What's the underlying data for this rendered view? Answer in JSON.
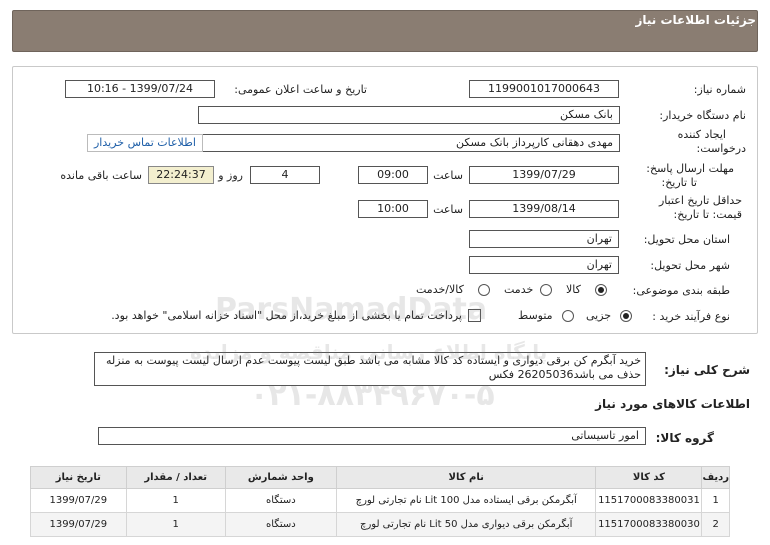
{
  "header": {
    "title": "جزئیات اطلاعات نیاز"
  },
  "form": {
    "need_number_label": "شماره نیاز:",
    "need_number": "1199001017000643",
    "announce_label": "تاریخ و ساعت اعلان عمومی:",
    "announce_value": "1399/07/24 - 10:16",
    "buyer_org_label": "نام دستگاه خریدار:",
    "buyer_org": "بانک مسکن",
    "creator_label_1": "ایجاد کننده",
    "creator_label_2": "درخواست:",
    "creator": "مهدی دهقانی کارپرداز بانک مسکن",
    "contact_link": "اطلاعات تماس خریدار",
    "reply_deadline_label_1": "مهلت ارسال پاسخ:",
    "reply_deadline_label_2": "تا تاریخ:",
    "reply_date": "1399/07/29",
    "time_label": "ساعت",
    "reply_time": "09:00",
    "days_value": "4",
    "days_label": "روز و",
    "remaining_time": "22:24:37",
    "remaining_label": "ساعت باقی مانده",
    "price_validity_label_1": "حداقل تاریخ اعتبار",
    "price_validity_label_2": "قیمت: تا تاریخ:",
    "price_date": "1399/08/14",
    "price_time_label": "ساعت",
    "price_time": "10:00",
    "province_label": "استان محل تحویل:",
    "province": "تهران",
    "city_label": "شهر محل تحویل:",
    "city": "تهران",
    "category_label": "طبقه بندی موضوعی:",
    "category_options": [
      "کالا",
      "خدمت",
      "کالا/خدمت"
    ],
    "category_selected": "کالا",
    "process_label": "نوع فرآیند خرید :",
    "process_options": [
      "جزیی",
      "متوسط"
    ],
    "process_selected": "جزیی",
    "payment_note": "پرداخت تمام یا بخشی از مبلغ خرید،از محل \"اسناد خزانه اسلامی\" خواهد بود."
  },
  "description": {
    "label": "شرح کلی نیاز:",
    "text": "خرید آبگرم کن برقی دیواری و ایستاده  کد کالا مشابه می باشد طبق لیست پیوست عدم ارسال لیست پیوست به منزله حذف می باشد26205036 فکس"
  },
  "goods": {
    "section_title": "اطلاعات کالاهای مورد نیاز",
    "group_label": "گروه کالا:",
    "group_value": "امور تاسیساتی",
    "columns": [
      "ردیف",
      "کد کالا",
      "نام کالا",
      "واحد شمارش",
      "تعداد / مقدار",
      "تاریخ نیاز"
    ],
    "rows": [
      [
        "1",
        "1151700083380031",
        "آبگرمکن برقی ایستاده مدل Lit 100 نام تجارتی لورچ",
        "دستگاه",
        "1",
        "1399/07/29"
      ],
      [
        "2",
        "1151700083380030",
        "آبگرمکن برقی دیواری مدل Lit 50 نام تجارتی لورچ",
        "دستگاه",
        "1",
        "1399/07/29"
      ]
    ]
  },
  "watermark": {
    "line1": "ParsNamadData",
    "line2": "پایگاه اطلاع رسانی مناقصه و مزایده",
    "line3": "۰۲۱-۸۸۳۴۹۶۷۰-۵"
  }
}
